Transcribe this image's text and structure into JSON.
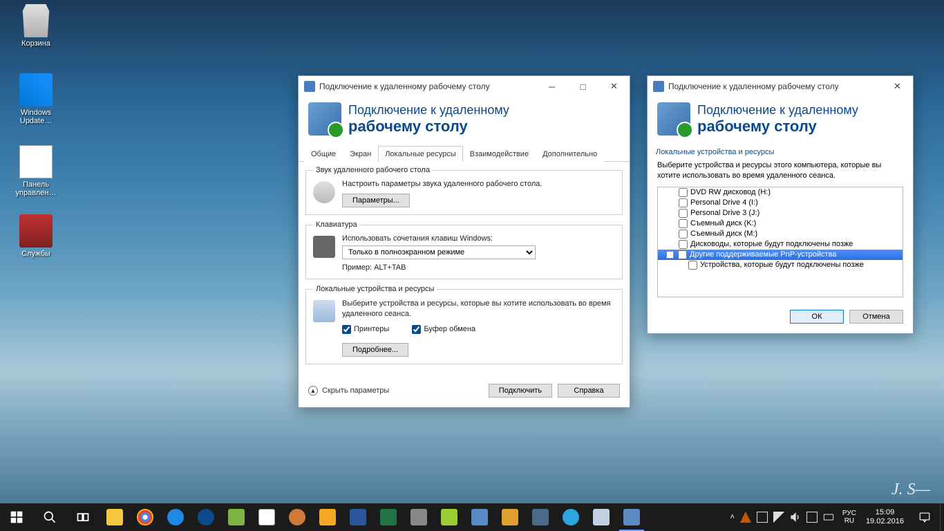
{
  "desktop_icons": {
    "recycle": "Корзина",
    "wu": "Windows Update…",
    "panel": "Панель управлен…",
    "services": "Службы"
  },
  "win1": {
    "title": "Подключение к удаленному рабочему столу",
    "header1": "Подключение к удаленному",
    "header2": "рабочему столу",
    "tabs": {
      "general": "Общие",
      "display": "Экран",
      "local": "Локальные ресурсы",
      "experience": "Взаимодействие",
      "advanced": "Дополнительно"
    },
    "audio": {
      "legend": "Звук удаленного рабочего стола",
      "desc": "Настроить параметры звука удаленного рабочего стола.",
      "btn": "Параметры..."
    },
    "keyboard": {
      "legend": "Клавиатура",
      "desc": "Использовать сочетания клавиш Windows:",
      "selected": "Только в полноэкранном режиме",
      "example": "Пример: ALT+TAB"
    },
    "localres": {
      "legend": "Локальные устройства и ресурсы",
      "desc": "Выберите устройства и ресурсы, которые вы хотите использовать во время удаленного сеанса.",
      "printers": "Принтеры",
      "clipboard": "Буфер обмена",
      "more_btn": "Подробнее..."
    },
    "footer": {
      "hide": "Скрыть параметры",
      "connect": "Подключить",
      "help": "Справка"
    }
  },
  "win2": {
    "title": "Подключение к удаленному рабочему столу",
    "header1": "Подключение к удаленному",
    "header2": "рабочему столу",
    "section": "Локальные устройства и ресурсы",
    "intro": "Выберите устройства и ресурсы этого компьютера, которые вы хотите использовать во время удаленного сеанса.",
    "tree": {
      "dvd": "DVD RW дисковод (H:)",
      "pd4": "Personal Drive 4 (I:)",
      "pd3": "Personal Drive 3 (J:)",
      "remk": "Съемный диск (K:)",
      "remm": "Съемный диск (M:)",
      "drives_later": "Дисководы, которые будут подключены позже",
      "pnp": "Другие поддерживаемые PnP-устройства",
      "dev_later": "Устройства, которые будут подключены позже"
    },
    "ok": "ОК",
    "cancel": "Отмена"
  },
  "taskbar": {
    "lang1": "РУС",
    "lang2": "RU",
    "time": "15:09",
    "date": "19.02.2016"
  }
}
